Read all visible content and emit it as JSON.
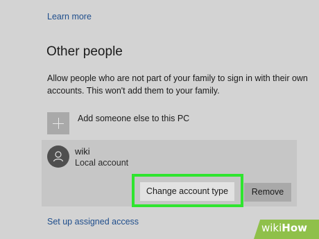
{
  "links": {
    "learn_more": "Learn more",
    "assigned_access": "Set up assigned access"
  },
  "other_people": {
    "title": "Other people",
    "description": "Allow people who are not part of your family to sign in with their own accounts. This won't add them to your family.",
    "add_label": "Add someone else to this PC"
  },
  "account": {
    "name": "wiki",
    "type": "Local account",
    "change_button": "Change account type",
    "remove_button": "Remove"
  },
  "watermark": {
    "part1": "wiki",
    "part2": "How"
  },
  "colors": {
    "background": "#d3d3d3",
    "link": "#1f4e8c",
    "highlight": "#2fe52f",
    "avatar": "#4f4f4f",
    "watermark": "#8fc04a"
  },
  "icons": {
    "add": "plus-icon",
    "avatar": "person-icon"
  }
}
